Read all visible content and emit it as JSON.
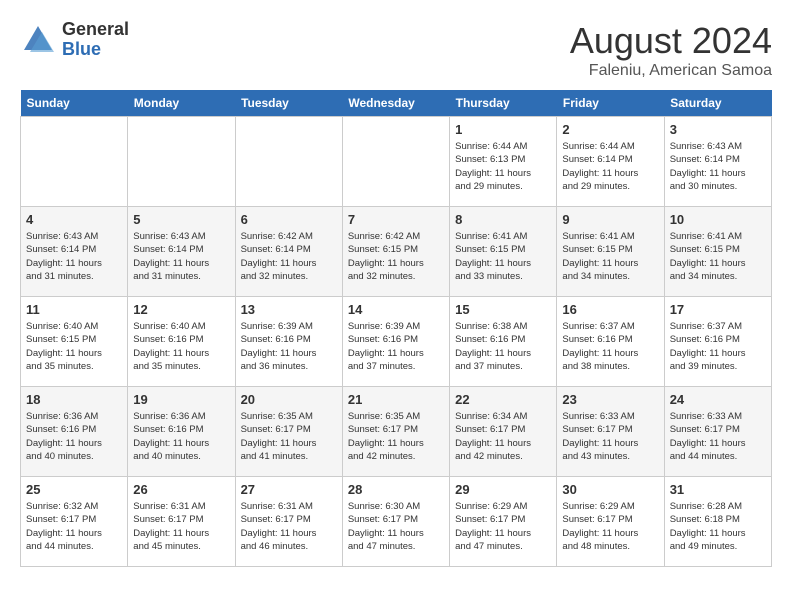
{
  "header": {
    "logo_general": "General",
    "logo_blue": "Blue",
    "month_year": "August 2024",
    "location": "Faleniu, American Samoa"
  },
  "weekdays": [
    "Sunday",
    "Monday",
    "Tuesday",
    "Wednesday",
    "Thursday",
    "Friday",
    "Saturday"
  ],
  "weeks": [
    [
      {
        "day": "",
        "info": ""
      },
      {
        "day": "",
        "info": ""
      },
      {
        "day": "",
        "info": ""
      },
      {
        "day": "",
        "info": ""
      },
      {
        "day": "1",
        "info": "Sunrise: 6:44 AM\nSunset: 6:13 PM\nDaylight: 11 hours\nand 29 minutes."
      },
      {
        "day": "2",
        "info": "Sunrise: 6:44 AM\nSunset: 6:14 PM\nDaylight: 11 hours\nand 29 minutes."
      },
      {
        "day": "3",
        "info": "Sunrise: 6:43 AM\nSunset: 6:14 PM\nDaylight: 11 hours\nand 30 minutes."
      }
    ],
    [
      {
        "day": "4",
        "info": "Sunrise: 6:43 AM\nSunset: 6:14 PM\nDaylight: 11 hours\nand 31 minutes."
      },
      {
        "day": "5",
        "info": "Sunrise: 6:43 AM\nSunset: 6:14 PM\nDaylight: 11 hours\nand 31 minutes."
      },
      {
        "day": "6",
        "info": "Sunrise: 6:42 AM\nSunset: 6:14 PM\nDaylight: 11 hours\nand 32 minutes."
      },
      {
        "day": "7",
        "info": "Sunrise: 6:42 AM\nSunset: 6:15 PM\nDaylight: 11 hours\nand 32 minutes."
      },
      {
        "day": "8",
        "info": "Sunrise: 6:41 AM\nSunset: 6:15 PM\nDaylight: 11 hours\nand 33 minutes."
      },
      {
        "day": "9",
        "info": "Sunrise: 6:41 AM\nSunset: 6:15 PM\nDaylight: 11 hours\nand 34 minutes."
      },
      {
        "day": "10",
        "info": "Sunrise: 6:41 AM\nSunset: 6:15 PM\nDaylight: 11 hours\nand 34 minutes."
      }
    ],
    [
      {
        "day": "11",
        "info": "Sunrise: 6:40 AM\nSunset: 6:15 PM\nDaylight: 11 hours\nand 35 minutes."
      },
      {
        "day": "12",
        "info": "Sunrise: 6:40 AM\nSunset: 6:16 PM\nDaylight: 11 hours\nand 35 minutes."
      },
      {
        "day": "13",
        "info": "Sunrise: 6:39 AM\nSunset: 6:16 PM\nDaylight: 11 hours\nand 36 minutes."
      },
      {
        "day": "14",
        "info": "Sunrise: 6:39 AM\nSunset: 6:16 PM\nDaylight: 11 hours\nand 37 minutes."
      },
      {
        "day": "15",
        "info": "Sunrise: 6:38 AM\nSunset: 6:16 PM\nDaylight: 11 hours\nand 37 minutes."
      },
      {
        "day": "16",
        "info": "Sunrise: 6:37 AM\nSunset: 6:16 PM\nDaylight: 11 hours\nand 38 minutes."
      },
      {
        "day": "17",
        "info": "Sunrise: 6:37 AM\nSunset: 6:16 PM\nDaylight: 11 hours\nand 39 minutes."
      }
    ],
    [
      {
        "day": "18",
        "info": "Sunrise: 6:36 AM\nSunset: 6:16 PM\nDaylight: 11 hours\nand 40 minutes."
      },
      {
        "day": "19",
        "info": "Sunrise: 6:36 AM\nSunset: 6:16 PM\nDaylight: 11 hours\nand 40 minutes."
      },
      {
        "day": "20",
        "info": "Sunrise: 6:35 AM\nSunset: 6:17 PM\nDaylight: 11 hours\nand 41 minutes."
      },
      {
        "day": "21",
        "info": "Sunrise: 6:35 AM\nSunset: 6:17 PM\nDaylight: 11 hours\nand 42 minutes."
      },
      {
        "day": "22",
        "info": "Sunrise: 6:34 AM\nSunset: 6:17 PM\nDaylight: 11 hours\nand 42 minutes."
      },
      {
        "day": "23",
        "info": "Sunrise: 6:33 AM\nSunset: 6:17 PM\nDaylight: 11 hours\nand 43 minutes."
      },
      {
        "day": "24",
        "info": "Sunrise: 6:33 AM\nSunset: 6:17 PM\nDaylight: 11 hours\nand 44 minutes."
      }
    ],
    [
      {
        "day": "25",
        "info": "Sunrise: 6:32 AM\nSunset: 6:17 PM\nDaylight: 11 hours\nand 44 minutes."
      },
      {
        "day": "26",
        "info": "Sunrise: 6:31 AM\nSunset: 6:17 PM\nDaylight: 11 hours\nand 45 minutes."
      },
      {
        "day": "27",
        "info": "Sunrise: 6:31 AM\nSunset: 6:17 PM\nDaylight: 11 hours\nand 46 minutes."
      },
      {
        "day": "28",
        "info": "Sunrise: 6:30 AM\nSunset: 6:17 PM\nDaylight: 11 hours\nand 47 minutes."
      },
      {
        "day": "29",
        "info": "Sunrise: 6:29 AM\nSunset: 6:17 PM\nDaylight: 11 hours\nand 47 minutes."
      },
      {
        "day": "30",
        "info": "Sunrise: 6:29 AM\nSunset: 6:17 PM\nDaylight: 11 hours\nand 48 minutes."
      },
      {
        "day": "31",
        "info": "Sunrise: 6:28 AM\nSunset: 6:18 PM\nDaylight: 11 hours\nand 49 minutes."
      }
    ]
  ]
}
